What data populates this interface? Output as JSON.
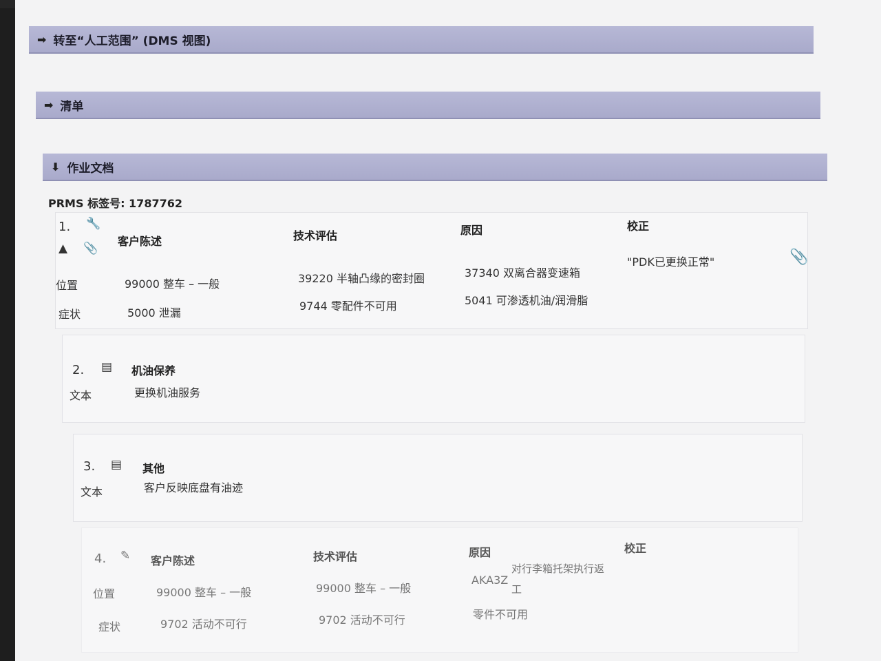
{
  "sections": {
    "goto_label": "转至“人工范围” (DMS 视图)",
    "checklist_label": "清单",
    "job_docs_label": "作业文档"
  },
  "prms": {
    "label": "PRMS 标签号:",
    "value": "1787762"
  },
  "headers": {
    "customer": "客户陈述",
    "tech": "技术评估",
    "cause": "原因",
    "correction": "校正"
  },
  "row_labels": {
    "position": "位置",
    "symptom": "症状",
    "text": "文本"
  },
  "item1": {
    "num": "1.",
    "customer_position": "99000 整车 – 一般",
    "customer_symptom": "5000 泄漏",
    "tech_position": "39220 半轴凸缘的密封圈",
    "tech_symptom": "9744 零配件不可用",
    "cause_position": "37340 双离合器变速箱",
    "cause_symptom": "5041 可渗透机油/润滑脂",
    "correction": "\"PDK已更换正常\""
  },
  "item2": {
    "num": "2.",
    "title": "机油保养",
    "text": "更换机油服务"
  },
  "item3": {
    "num": "3.",
    "title": "其他",
    "text": "客户反映底盘有油迹"
  },
  "item4": {
    "num": "4.",
    "customer_position": "99000 整车 – 一般",
    "customer_symptom": "9702 活动不可行",
    "tech_position": "99000 整车 – 一般",
    "tech_symptom": "9702 活动不可行",
    "cause_code": "AKA3Z",
    "cause_desc_1": "对行李箱托架执行返",
    "cause_desc_2": "工",
    "cause_symptom": "零件不可用"
  },
  "icons": {
    "section_arrow": "arrow-right-icon",
    "section_arrow_down": "arrow-down-icon",
    "wrench": "wrench-icon",
    "bottle": "oil-bottle-icon",
    "clip": "paperclip-icon",
    "doc": "document-icon",
    "edit": "edit-icon"
  },
  "colors": {
    "header_bar": "#b7b8d6",
    "screen_bg": "#f3f3f4"
  }
}
